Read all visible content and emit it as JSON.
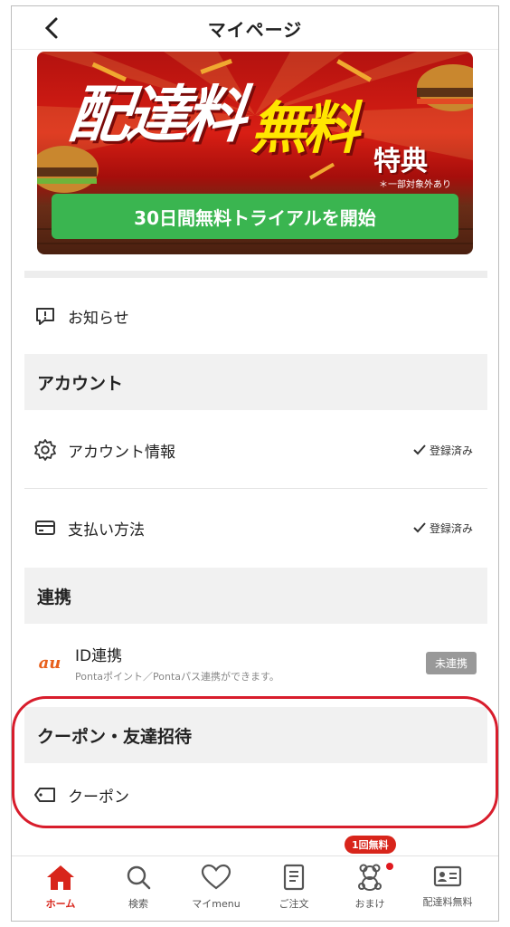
{
  "header": {
    "title": "マイページ"
  },
  "banner": {
    "headline_part1": "配達料",
    "headline_part2": "無料",
    "headline_part3": "特典",
    "note": "＊一部対象外あり",
    "cta_label": "30日間無料トライアルを開始"
  },
  "menu": {
    "notice_label": "お知らせ",
    "account_section": "アカウント",
    "account_info_label": "アカウント情報",
    "account_info_status": "登録済み",
    "payment_label": "支払い方法",
    "payment_status": "登録済み",
    "link_section": "連携",
    "au_logo": "au",
    "id_link_label": "ID連携",
    "id_link_sub": "Pontaポイント／Pontaパス連携ができます。",
    "id_link_status": "未連携",
    "coupon_section": "クーポン・友達招待",
    "coupon_label": "クーポン"
  },
  "tabbar": {
    "home": "ホーム",
    "search": "検索",
    "mymenu": "マイmenu",
    "orders": "ご注文",
    "omake": "おまけ",
    "omake_badge": "1回無料",
    "free_delivery": "配達料無料"
  },
  "colors": {
    "accent": "#d8251b",
    "cta": "#3ab550",
    "oval": "#d81d2c"
  }
}
